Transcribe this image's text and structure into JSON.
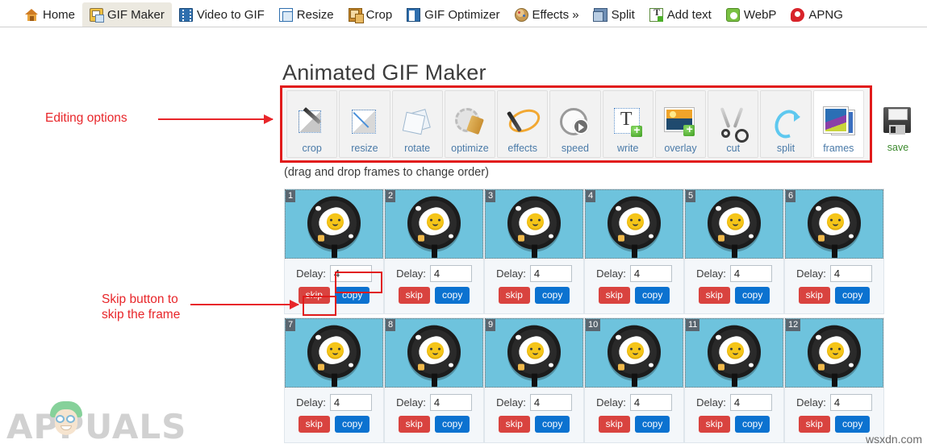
{
  "tabbar": {
    "tabs": [
      {
        "label": "Home",
        "icon": "home-icon",
        "active": false
      },
      {
        "label": "GIF Maker",
        "icon": "gif-maker-icon",
        "active": true
      },
      {
        "label": "Video to GIF",
        "icon": "video-icon",
        "active": false
      },
      {
        "label": "Resize",
        "icon": "resize-icon",
        "active": false
      },
      {
        "label": "Crop",
        "icon": "crop-icon",
        "active": false
      },
      {
        "label": "GIF Optimizer",
        "icon": "optimizer-icon",
        "active": false
      },
      {
        "label": "Effects »",
        "icon": "effects-palette-icon",
        "active": false
      },
      {
        "label": "Split",
        "icon": "split-icon",
        "active": false
      },
      {
        "label": "Add text",
        "icon": "add-text-icon",
        "active": false
      },
      {
        "label": "WebP",
        "icon": "webp-icon",
        "active": false
      },
      {
        "label": "APNG",
        "icon": "apng-icon",
        "active": false
      }
    ]
  },
  "page": {
    "title": "Animated GIF Maker",
    "drag_hint": "(drag and drop frames to change order)"
  },
  "toolbar": {
    "tools": [
      {
        "label": "crop",
        "icon": "crop-tool-icon",
        "selected": false
      },
      {
        "label": "resize",
        "icon": "resize-tool-icon",
        "selected": false
      },
      {
        "label": "rotate",
        "icon": "rotate-tool-icon",
        "selected": false
      },
      {
        "label": "optimize",
        "icon": "optimize-tool-icon",
        "selected": false
      },
      {
        "label": "effects",
        "icon": "effects-tool-icon",
        "selected": false
      },
      {
        "label": "speed",
        "icon": "speed-tool-icon",
        "selected": false
      },
      {
        "label": "write",
        "icon": "write-tool-icon",
        "selected": false
      },
      {
        "label": "overlay",
        "icon": "overlay-tool-icon",
        "selected": false
      },
      {
        "label": "cut",
        "icon": "cut-tool-icon",
        "selected": false
      },
      {
        "label": "split",
        "icon": "split-tool-icon",
        "selected": false
      },
      {
        "label": "frames",
        "icon": "frames-tool-icon",
        "selected": true
      }
    ],
    "save": {
      "label": "save",
      "icon": "save-floppy-icon"
    }
  },
  "frames": {
    "delay_label": "Delay:",
    "skip_label": "skip",
    "copy_label": "copy",
    "items": [
      {
        "number": "1",
        "delay": "4"
      },
      {
        "number": "2",
        "delay": "4"
      },
      {
        "number": "3",
        "delay": "4"
      },
      {
        "number": "4",
        "delay": "4"
      },
      {
        "number": "5",
        "delay": "4"
      },
      {
        "number": "6",
        "delay": "4"
      },
      {
        "number": "7",
        "delay": "4"
      },
      {
        "number": "8",
        "delay": "4"
      },
      {
        "number": "9",
        "delay": "4"
      },
      {
        "number": "10",
        "delay": "4"
      },
      {
        "number": "11",
        "delay": "4"
      },
      {
        "number": "12",
        "delay": "4"
      }
    ]
  },
  "annotations": {
    "editing_options": "Editing options",
    "skip_button": "Skip button to\nskip the frame",
    "skip_button_line1": "Skip button to",
    "skip_button_line2": "skip the frame"
  },
  "watermarks": {
    "brand": "APPUALS",
    "source": "wsxdn.com"
  },
  "colors": {
    "annotation_red": "#e8262a",
    "highlight_red": "#e11b1b",
    "skip_button": "#d9433f",
    "copy_button": "#0b72d0",
    "tool_label": "#4a7aa8",
    "save_label": "#3d8a2e",
    "frame_bg": "#6ec3dd",
    "active_tab_bg": "#ece9e0"
  }
}
